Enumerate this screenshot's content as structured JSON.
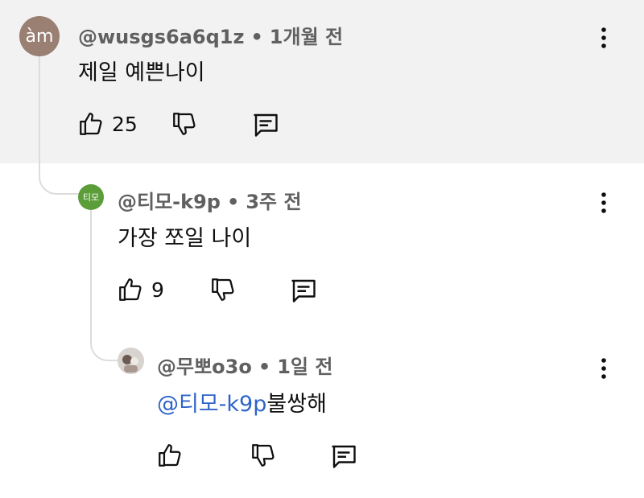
{
  "comments": [
    {
      "avatar_text": "àm",
      "avatar_color": "#9a7f73",
      "handle": "@wusgs6a6q1z",
      "separator": "•",
      "time": "1개월 전",
      "text": "제일 예쁜나이",
      "likes": "25"
    },
    {
      "avatar_text": "티모",
      "avatar_color": "#5a9d39",
      "handle": "@티모-k9p",
      "separator": "•",
      "time": "3주 전",
      "text": "가장 쪼일 나이",
      "likes": "9"
    },
    {
      "handle": "@무뽀o3o",
      "separator": "•",
      "time": "1일 전",
      "mention": "@티모-k9p",
      "text": "불쌍해",
      "likes": ""
    }
  ],
  "colors": {
    "highlight_bg": "#f2f2f2",
    "mention": "#2e64c8",
    "meta_text": "#606060"
  }
}
